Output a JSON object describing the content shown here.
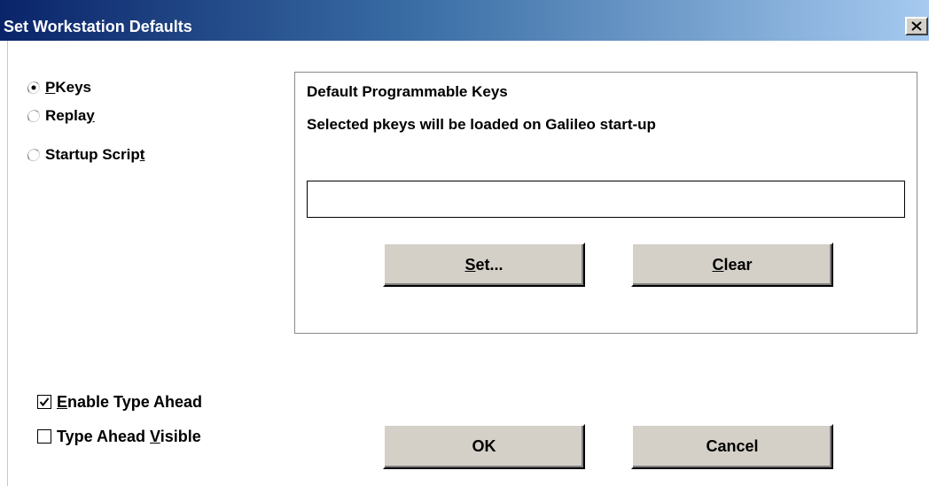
{
  "window": {
    "title": "Set Workstation Defaults"
  },
  "mode_options": [
    {
      "pre": "",
      "accel": "P",
      "post": "Keys",
      "selected": true
    },
    {
      "pre": "Repla",
      "accel": "y",
      "post": "",
      "selected": false
    },
    {
      "pre": "Startup Scrip",
      "accel": "t",
      "post": "",
      "selected": false
    }
  ],
  "group": {
    "heading": "Default Programmable Keys",
    "description": "Selected pkeys will be loaded on Galileo start-up",
    "field_value": ""
  },
  "buttons": {
    "set": {
      "accel": "S",
      "rest": "et..."
    },
    "clear": {
      "accel": "C",
      "rest": "lear"
    },
    "ok": "OK",
    "cancel": "Cancel"
  },
  "options": {
    "type_ahead": {
      "pre": "",
      "accel": "E",
      "post": "nable Type Ahead",
      "checked": true
    },
    "type_ahead_visible": {
      "pre": "Type Ahead ",
      "accel": "V",
      "post": "isible",
      "checked": false
    }
  }
}
